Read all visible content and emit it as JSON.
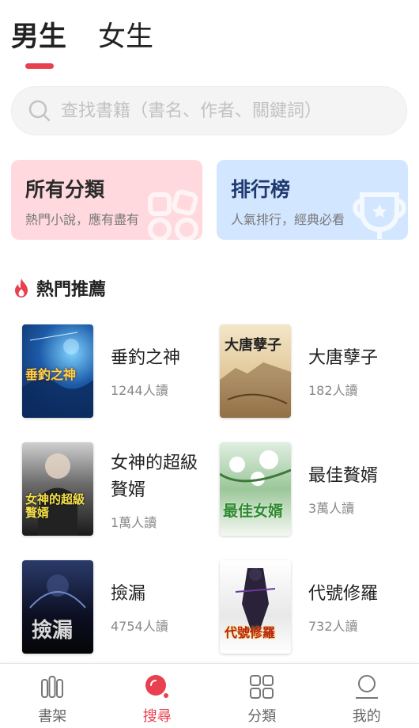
{
  "colors": {
    "accent": "#e8404e",
    "card_cat_bg": "#ffd9dd",
    "card_rank_bg": "#d3e6ff"
  },
  "gender_tabs": [
    {
      "label": "男生",
      "active": true
    },
    {
      "label": "女生",
      "active": false
    }
  ],
  "search": {
    "placeholder": "查找書籍（書名、作者、關鍵詞）",
    "icon": "search-icon"
  },
  "cards": {
    "categories": {
      "title": "所有分類",
      "subtitle": "熱門小說，應有盡有",
      "icon": "shapes-icon"
    },
    "ranking": {
      "title": "排行榜",
      "subtitle": "人氣排行，經典必看",
      "icon": "trophy-icon"
    }
  },
  "section": {
    "title": "熱門推薦",
    "icon": "fire-icon"
  },
  "books": [
    {
      "title": "垂釣之神",
      "reads": "1244人讀",
      "cover_text": "垂釣之神"
    },
    {
      "title": "大唐孽子",
      "reads": "182人讀",
      "cover_text": "大唐孽子"
    },
    {
      "title": "女神的超級贅婿",
      "reads": "1萬人讀",
      "cover_text": "女神的超級贅婿"
    },
    {
      "title": "最佳贅婿",
      "reads": "3萬人讀",
      "cover_text": "最佳女婿"
    },
    {
      "title": "撿漏",
      "reads": "4754人讀",
      "cover_text": "撿漏"
    },
    {
      "title": "代號修羅",
      "reads": "732人讀",
      "cover_text": "代號修羅"
    }
  ],
  "bottom_nav": [
    {
      "label": "書架",
      "icon": "bookshelf-icon",
      "active": false
    },
    {
      "label": "搜尋",
      "icon": "search-icon",
      "active": true
    },
    {
      "label": "分類",
      "icon": "grid-icon",
      "active": false
    },
    {
      "label": "我的",
      "icon": "profile-icon",
      "active": false
    }
  ]
}
